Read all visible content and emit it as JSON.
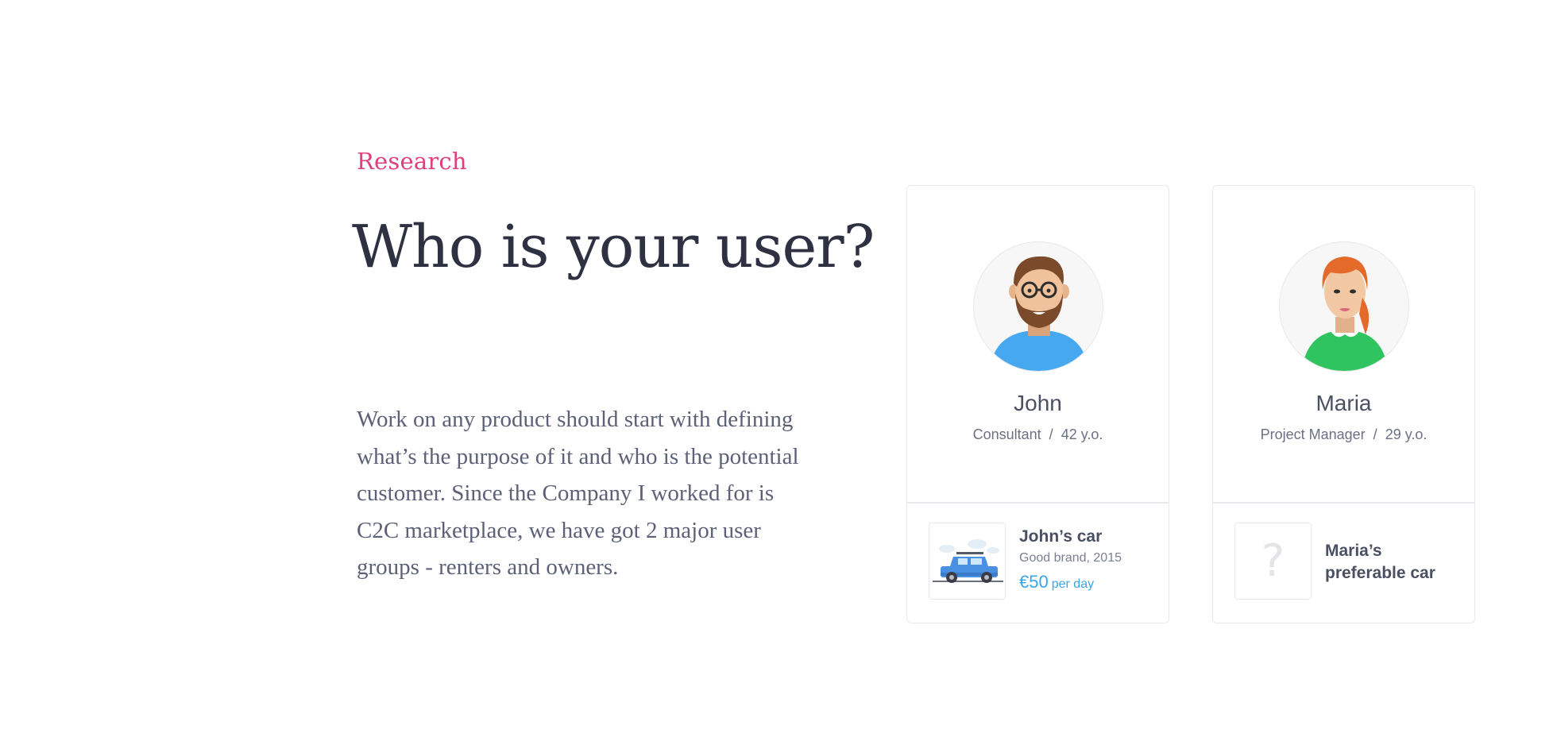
{
  "section": {
    "eyebrow": "Research",
    "headline": "Who is your user?",
    "body": "Work on any product should start with defining what’s the purpose of it and who is the potential customer. Since the Company I worked for is C2C marketplace, we have got 2 major user groups - renters and owners."
  },
  "users": [
    {
      "name": "John",
      "role": "Consultant",
      "separator": "/",
      "age": "42 y.o.",
      "avatar_icon": "bearded-man-avatar-icon",
      "car": {
        "title": "John’s car",
        "subtitle": "Good brand, 2015",
        "price": "€50",
        "price_unit": "per day",
        "thumb_icon": "blue-suv-icon"
      }
    },
    {
      "name": "Maria",
      "role": "Project Manager",
      "separator": "/",
      "age": "29 y.o.",
      "avatar_icon": "red-haired-woman-avatar-icon",
      "car": {
        "title": "Maria’s preferable car",
        "placeholder": "?",
        "thumb_icon": "question-mark-icon"
      }
    }
  ],
  "colors": {
    "accent": "#e0407a",
    "heading": "#2d3142",
    "body": "#5c6178",
    "price": "#3aa6e8",
    "border": "#e9eaee"
  }
}
